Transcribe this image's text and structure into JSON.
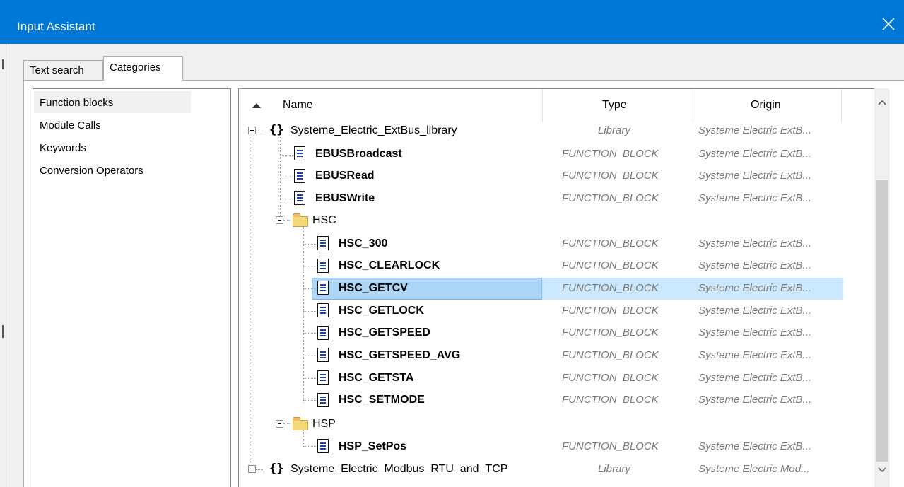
{
  "window": {
    "title": "Input Assistant"
  },
  "tabs": [
    {
      "label": "Text search",
      "active": false
    },
    {
      "label": "Categories",
      "active": true
    }
  ],
  "categories": [
    {
      "label": "Function blocks",
      "selected": true
    },
    {
      "label": "Module Calls",
      "selected": false
    },
    {
      "label": "Keywords",
      "selected": false
    },
    {
      "label": "Conversion Operators",
      "selected": false
    }
  ],
  "columns": {
    "name": "Name",
    "type": "Type",
    "origin": "Origin"
  },
  "tree": [
    {
      "name": "Systeme_Electric_ExtBus_library",
      "type": "Library",
      "origin": "Systeme Electric ExtB...",
      "kind": "library",
      "expanded": true
    },
    {
      "name": "EBUSBroadcast",
      "type": "FUNCTION_BLOCK",
      "origin": "Systeme Electric ExtB...",
      "kind": "fb"
    },
    {
      "name": "EBUSRead",
      "type": "FUNCTION_BLOCK",
      "origin": "Systeme Electric ExtB...",
      "kind": "fb"
    },
    {
      "name": "EBUSWrite",
      "type": "FUNCTION_BLOCK",
      "origin": "Systeme Electric ExtB...",
      "kind": "fb"
    },
    {
      "name": "HSC",
      "type": "",
      "origin": "",
      "kind": "folder",
      "expanded": true
    },
    {
      "name": "HSC_300",
      "type": "FUNCTION_BLOCK",
      "origin": "Systeme Electric ExtB...",
      "kind": "fb"
    },
    {
      "name": "HSC_CLEARLOCK",
      "type": "FUNCTION_BLOCK",
      "origin": "Systeme Electric ExtB...",
      "kind": "fb"
    },
    {
      "name": "HSC_GETCV",
      "type": "FUNCTION_BLOCK",
      "origin": "Systeme Electric ExtB...",
      "kind": "fb",
      "selected": true
    },
    {
      "name": "HSC_GETLOCK",
      "type": "FUNCTION_BLOCK",
      "origin": "Systeme Electric ExtB...",
      "kind": "fb"
    },
    {
      "name": "HSC_GETSPEED",
      "type": "FUNCTION_BLOCK",
      "origin": "Systeme Electric ExtB...",
      "kind": "fb"
    },
    {
      "name": "HSC_GETSPEED_AVG",
      "type": "FUNCTION_BLOCK",
      "origin": "Systeme Electric ExtB...",
      "kind": "fb"
    },
    {
      "name": "HSC_GETSTA",
      "type": "FUNCTION_BLOCK",
      "origin": "Systeme Electric ExtB...",
      "kind": "fb"
    },
    {
      "name": "HSC_SETMODE",
      "type": "FUNCTION_BLOCK",
      "origin": "Systeme Electric ExtB...",
      "kind": "fb"
    },
    {
      "name": "HSP",
      "type": "",
      "origin": "",
      "kind": "folder",
      "expanded": true
    },
    {
      "name": "HSP_SetPos",
      "type": "FUNCTION_BLOCK",
      "origin": "Systeme Electric ExtB...",
      "kind": "fb"
    },
    {
      "name": "Systeme_Electric_Modbus_RTU_and_TCP",
      "type": "Library",
      "origin": "Systeme Electric Mod...",
      "kind": "library",
      "expanded": false
    }
  ],
  "icons": {
    "close": "close-icon",
    "library": "library-braces-icon",
    "folder": "folder-icon",
    "function_block": "function-block-document-icon",
    "sort": "sort-ascending-icon"
  },
  "colors": {
    "titlebar": "#0078d7",
    "selection": "#cce8ff",
    "italic_text": "#7a7a7a"
  }
}
